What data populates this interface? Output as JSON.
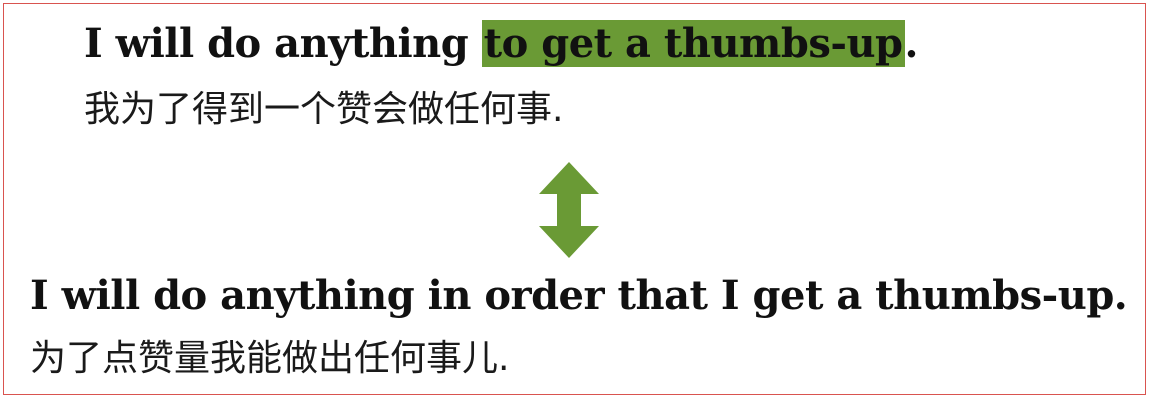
{
  "sentence_1": {
    "before": "I will do anything ",
    "highlighted": "to get a thumbs-up",
    "after": "."
  },
  "translation_1": "我为了得到一个赞会做任何事.",
  "sentence_2": "I will do anything in order that I get a thumbs-up.",
  "translation_2": "为了点赞量我能做出任何事儿.",
  "colors": {
    "highlight": "#6a9a35",
    "arrow": "#6a9a35",
    "border": "#d9534f"
  },
  "icons": {
    "arrow": "up-down-arrow-icon"
  }
}
